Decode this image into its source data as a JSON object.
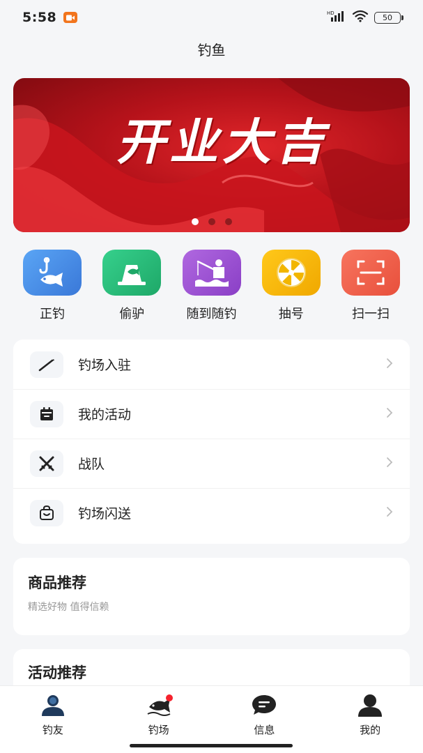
{
  "status_bar": {
    "time": "5:58",
    "battery": "50",
    "network": "HD"
  },
  "header": {
    "title": "钓鱼"
  },
  "banner": {
    "headline": "开业大吉",
    "page_count": 3,
    "active_page": 1
  },
  "quick_actions": [
    {
      "label": "正钓",
      "icon": "fishing-hook-icon",
      "color": "#4a8de8"
    },
    {
      "label": "偷驴",
      "icon": "fish-sign-icon",
      "color": "#2ec07a"
    },
    {
      "label": "随到随钓",
      "icon": "angler-icon",
      "color": "#9a4fd1"
    },
    {
      "label": "抽号",
      "icon": "wheel-icon",
      "color": "#f2b600"
    },
    {
      "label": "扫一扫",
      "icon": "scan-icon",
      "color": "#f0624d"
    }
  ],
  "menu": [
    {
      "label": "钓场入驻",
      "icon": "fishing-rod-icon"
    },
    {
      "label": "我的活动",
      "icon": "calendar-icon"
    },
    {
      "label": "战队",
      "icon": "crossed-swords-icon"
    },
    {
      "label": "钓场闪送",
      "icon": "shopping-bag-icon"
    }
  ],
  "product_section": {
    "title": "商品推荐",
    "subtitle": "精选好物 值得信赖"
  },
  "activity_section": {
    "title": "活动推荐"
  },
  "tabbar": [
    {
      "label": "钓友",
      "icon": "user-group-icon"
    },
    {
      "label": "钓场",
      "icon": "fish-pond-icon",
      "badge": true
    },
    {
      "label": "信息",
      "icon": "message-icon"
    },
    {
      "label": "我的",
      "icon": "profile-icon"
    }
  ],
  "colors": {
    "accent_red": "#d3141c",
    "background": "#f5f6f8"
  }
}
